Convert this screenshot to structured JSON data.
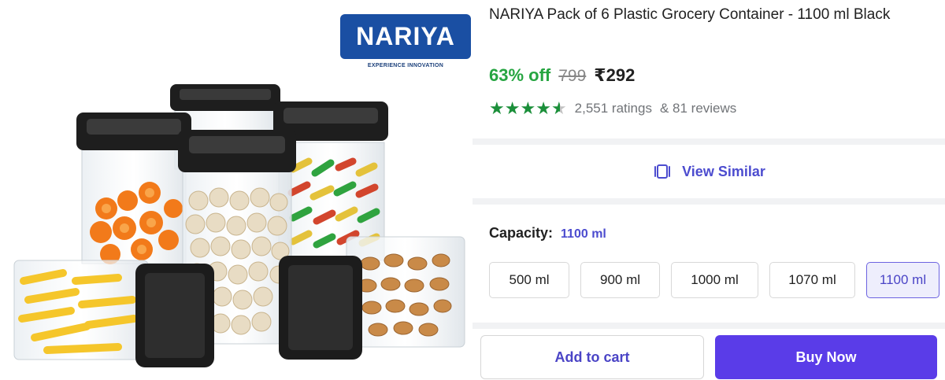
{
  "brand": {
    "logo_text": "NARIYA",
    "tagline": "EXPERIENCE INNOVATION"
  },
  "product": {
    "title": "NARIYA Pack of 6 Plastic Grocery Container  - 1100 ml Black",
    "discount": "63% off",
    "mrp": "799",
    "price": "₹292",
    "rating_value": 4.5,
    "ratings_count": "2,551 ratings",
    "reviews_count": "& 81 reviews"
  },
  "actions": {
    "view_similar": "View Similar",
    "add_to_cart": "Add to cart",
    "buy_now": "Buy Now"
  },
  "capacity": {
    "label": "Capacity:",
    "selected": "1100 ml",
    "options": [
      "500 ml",
      "900 ml",
      "1000 ml",
      "1070 ml",
      "1100 ml"
    ]
  },
  "icons": {
    "star": "star-icon",
    "view_similar": "view-similar-icon"
  },
  "colors": {
    "discount_green": "#26a541",
    "star_green": "#1b8f3a",
    "accent_purple": "#4c4ccf",
    "buy_now_bg": "#5a3ce8",
    "brand_blue": "#1a4fa3"
  }
}
